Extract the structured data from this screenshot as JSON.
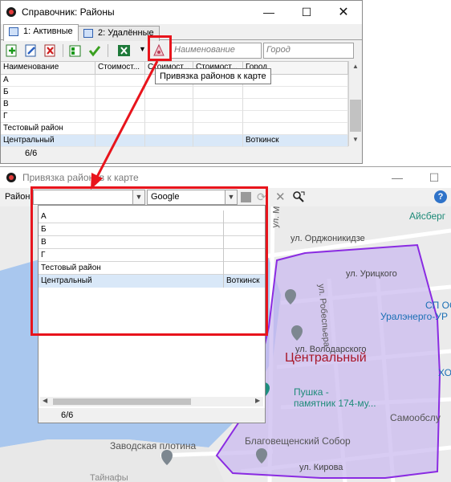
{
  "window1": {
    "title": "Справочник: Районы",
    "tabs": [
      "1: Активные",
      "2: Удалённые"
    ],
    "filter_name_placeholder": "Наименование",
    "filter_city_placeholder": "Город",
    "columns": [
      "Наименование",
      "Стоимост...",
      "Стоимост...",
      "Стоимост...",
      "Город"
    ],
    "rows": [
      {
        "name": "А",
        "city": ""
      },
      {
        "name": "Б",
        "city": ""
      },
      {
        "name": "В",
        "city": ""
      },
      {
        "name": "Г",
        "city": ""
      },
      {
        "name": "Тестовый район",
        "city": ""
      },
      {
        "name": "Центральный",
        "city": "Воткинск"
      }
    ],
    "record_count": "6/6",
    "tooltip": "Привязка районов к карте"
  },
  "window2": {
    "title": "Привязка районов к карте",
    "district_label": "Район",
    "district_value": "",
    "map_provider": "Google",
    "dropdown_rows": [
      {
        "name": "А",
        "city": ""
      },
      {
        "name": "Б",
        "city": ""
      },
      {
        "name": "В",
        "city": ""
      },
      {
        "name": "Г",
        "city": ""
      },
      {
        "name": "Тестовый район",
        "city": ""
      },
      {
        "name": "Центральный",
        "city": "Воткинск"
      }
    ],
    "dropdown_count": "6/6"
  },
  "map": {
    "district_label": "Центральный",
    "streets": [
      "ул. Мира",
      "ул. Орджоникидзе",
      "ул. Урицкого",
      "ул. Робеспьера",
      "ул. Володарского",
      "ул. Кирова"
    ],
    "places": [
      "Айсберг",
      "СП ОС",
      "Уралэнерго-УР",
      "Пушка -",
      "памятник 174-му...",
      "Самообслу",
      "Заводская плотина",
      "Благовещенский Собор",
      "ХОЗ",
      "Тайнафы"
    ]
  },
  "colors": {
    "highlight": "#e8141c",
    "district_fill": "#c9b8ee",
    "district_stroke": "#8a2be2",
    "water": "#a9c7ee",
    "selection": "#d9e8f8"
  }
}
